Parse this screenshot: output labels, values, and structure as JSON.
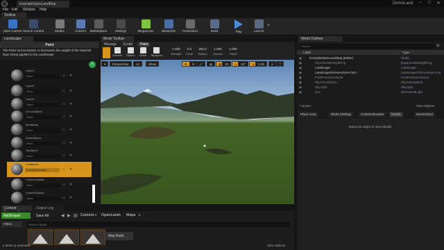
{
  "window": {
    "tab_label": "ExampleOpenLandMap",
    "project_name": "DemoLand"
  },
  "menu": [
    "File",
    "Edit",
    "Window",
    "Help"
  ],
  "toolbar": {
    "tab_label": "Toolbar",
    "buttons": [
      {
        "label": "Save Current",
        "icon": "save-icon",
        "color": "#3a72c4"
      },
      {
        "label": "Source Control",
        "icon": "source-control-icon",
        "color": "#3c4c68"
      },
      {
        "label": "Modes",
        "icon": "modes-icon",
        "color": "#7a7a7a"
      },
      {
        "label": "Content",
        "icon": "content-icon",
        "color": "#5a7ab0"
      },
      {
        "label": "Marketplace",
        "icon": "marketplace-icon",
        "color": "#5c5c5c"
      },
      {
        "label": "Settings",
        "icon": "settings-icon",
        "color": "#4a4a4a"
      },
      {
        "label": "Megascans",
        "icon": "megascans-icon",
        "color": "#7ec242"
      },
      {
        "label": "Blueprints",
        "icon": "blueprints-icon",
        "color": "#4a6ea8"
      },
      {
        "label": "Cinematics",
        "icon": "cinematics-icon",
        "color": "#6a6a6a"
      },
      {
        "label": "Build",
        "icon": "build-icon",
        "color": "#5a6a8a"
      },
      {
        "label": "Play",
        "icon": "play-icon",
        "color": "#4a8ad6"
      },
      {
        "label": "Launch",
        "icon": "launch-icon",
        "color": "#5a6a80"
      }
    ]
  },
  "landscape_panel": {
    "tab_label": "Landscape",
    "header": "Paint",
    "description": "The Paint tool increases or decreases the weight of the Material layer being applied to the Landscape",
    "layers": [
      {
        "name": "Layer1",
        "source": "None"
      },
      {
        "name": "Layer2",
        "source": "None"
      },
      {
        "name": "Layer3",
        "source": "None"
      },
      {
        "name": "GroundAlpha",
        "source": "None"
      },
      {
        "name": "MudAlpha",
        "source": "None"
      },
      {
        "name": "GravelAlpha",
        "source": "None"
      },
      {
        "name": "TopAlpha",
        "source": "None"
      },
      {
        "name": "LeafAlpha",
        "source": "LandscapeLayer",
        "selected": true
      },
      {
        "name": "Custom1Alpha",
        "source": "None"
      },
      {
        "name": "Custom2Alpha",
        "source": "None"
      }
    ]
  },
  "mode_toolbar": {
    "tab_label": "Mode Toolbar",
    "tabs": [
      "Manage",
      "Sculpt",
      "Paint"
    ],
    "active_tab": "Paint",
    "tools": [
      "Smooth",
      "Flatten",
      "Noise",
      "Blueprint"
    ],
    "params": [
      {
        "label": "Strength",
        "value": "1.000"
      },
      {
        "label": "Circle",
        "value": "0.3"
      },
      {
        "label": "Radius",
        "value": "333.3"
      },
      {
        "label": "Smooth",
        "value": "1.000"
      },
      {
        "label": "Falloff",
        "value": "1.000"
      }
    ]
  },
  "viewport": {
    "perspective": "Perspective",
    "lit": "Lit",
    "show": "Show",
    "grid_snap": "10",
    "rotation_snap": "10°",
    "scale_snap": "0.25",
    "camera_speed": "4"
  },
  "content_browser": {
    "tab_label": "Content Browser 2",
    "other_tab": "Output Log",
    "add_import": "Add/Import",
    "save_all": "Save All",
    "path": [
      "Content",
      "OpenLand",
      "Maps"
    ],
    "filters": "Filters",
    "search_placeholder": "Search Maps",
    "map_build": "Map Build",
    "items_count": "5 items (1 selected)",
    "view_options": "View Options"
  },
  "world_outliner": {
    "tab_label": "World Outliner",
    "search_placeholder": "Search...",
    "col_label": "Label",
    "col_type": "Type",
    "rows": [
      {
        "label": "ExampleOpenLandMap (Editor)",
        "type": "World",
        "indent": 0
      },
      {
        "label": "ExponentialHeightFog",
        "type": "ExponentialHeightFog",
        "indent": 1,
        "dim": true
      },
      {
        "label": "Landscape",
        "type": "Landscape",
        "indent": 1
      },
      {
        "label": "LandscapeGizmoActiveActor1",
        "type": "LandscapeGizmoActiveActor",
        "indent": 1
      },
      {
        "label": "PostProcessVolume",
        "type": "PostProcessVolume",
        "indent": 1,
        "dim": true
      },
      {
        "label": "SkyAtmosphere",
        "type": "SkyAtmosphere",
        "indent": 1,
        "dim": true
      },
      {
        "label": "SkyLight",
        "type": "SkyLight",
        "indent": 1,
        "dim": true
      },
      {
        "label": "Sun",
        "type": "DirectionalLight",
        "indent": 1,
        "dim": true
      }
    ],
    "actors_count": "7 actors",
    "view_options": "View Options"
  },
  "details": {
    "tabs": [
      "Place Actor",
      "World Settings",
      "Content Browser",
      "Details",
      "Hierarchical"
    ],
    "message": "Select an object to view details."
  },
  "colors": {
    "accent_orange": "#d8951c",
    "add_green": "#3b8a2b",
    "paint_green": "#2fa24b"
  }
}
